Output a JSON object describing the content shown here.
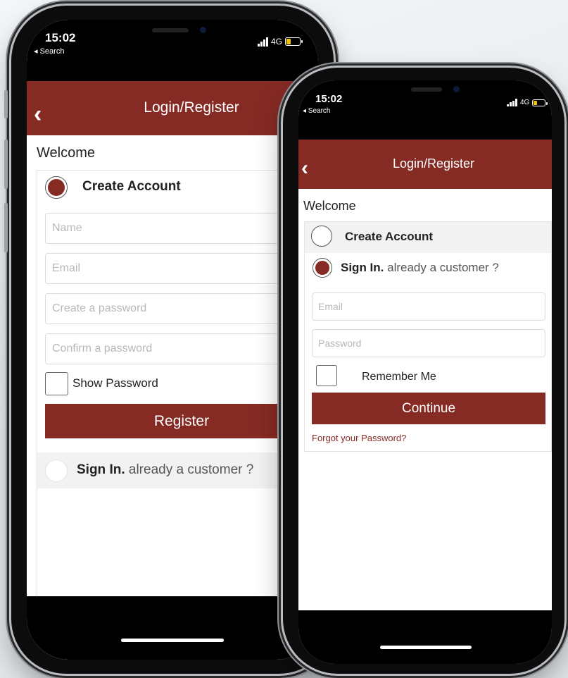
{
  "status_bar": {
    "time": "15:02",
    "back_label": "◂ Search",
    "network": "4G"
  },
  "header": {
    "title": "Login/Register",
    "back_icon": "‹"
  },
  "welcome": "Welcome",
  "colors": {
    "brand": "#862a24",
    "link": "#862a24"
  },
  "phone_left": {
    "create_account": {
      "label": "Create Account",
      "selected": true
    },
    "fields": [
      {
        "placeholder": "Name"
      },
      {
        "placeholder": "Email"
      },
      {
        "placeholder": "Create a password"
      },
      {
        "placeholder": "Confirm a password"
      }
    ],
    "show_password": "Show Password",
    "register_button": "Register",
    "sign_in": {
      "label": "Sign In.",
      "sublabel": "already a customer ?",
      "selected": false
    }
  },
  "phone_right": {
    "create_account": {
      "label": "Create Account",
      "selected": false
    },
    "sign_in": {
      "label": "Sign In.",
      "sublabel": "already a customer ?",
      "selected": true
    },
    "fields": [
      {
        "placeholder": "Email"
      },
      {
        "placeholder": "Password"
      }
    ],
    "remember_me": "Remember Me",
    "continue_button": "Continue",
    "forgot_password": "Forgot your Password?"
  }
}
